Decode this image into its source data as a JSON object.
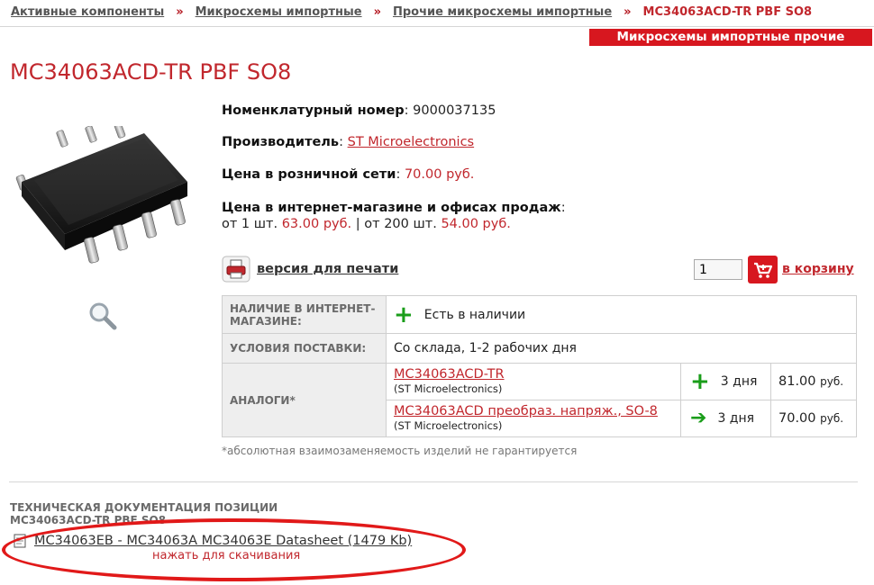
{
  "breadcrumb": {
    "items": [
      "Активные компоненты",
      "Микросхемы импортные",
      "Прочие микросхемы импортные"
    ],
    "separator": "»",
    "current": "MC34063ACD-TR PBF SO8"
  },
  "category_badge": "Микросхемы импортные прочие",
  "product": {
    "title": "MC34063ACD-TR PBF SO8",
    "nomenclature_label": "Номенклатурный номер",
    "nomenclature_value": "9000037135",
    "manufacturer_label": "Производитель",
    "manufacturer_value": "ST Microelectronics",
    "retail_price_label": "Цена в розничной сети",
    "retail_price_value": "70.00 руб.",
    "online_price_label": "Цена в интернет-магазине и офисах продаж",
    "tier1_prefix": "от 1 шт.",
    "tier1_price": "63.00 руб.",
    "tier_separator": "|",
    "tier2_prefix": "от 200 шт.",
    "tier2_price": "54.00 руб."
  },
  "actions": {
    "print_label": "версия для печати",
    "quantity_value": "1",
    "cart_label": "в корзину"
  },
  "specs": {
    "availability_label": "НАЛИЧИЕ В ИНТЕРНЕТ-МАГАЗИНЕ:",
    "availability_value": "Есть в наличии",
    "delivery_label": "УСЛОВИЯ ПОСТАВКИ:",
    "delivery_value": "Со склада, 1-2 рабочих дня",
    "analogs_label": "АНАЛОГИ*",
    "analogs": [
      {
        "name": "MC34063ACD-TR",
        "manufacturer": "(ST Microelectronics)",
        "term": "3 дня",
        "price": "81.00",
        "currency": "руб.",
        "icon": "plus-icon"
      },
      {
        "name": "MC34063ACD преобраз. напряж., SO-8",
        "manufacturer": "(ST Microelectronics)",
        "term": "3 дня",
        "price": "70.00",
        "currency": "руб.",
        "icon": "arrow-right-icon"
      }
    ]
  },
  "note": "*абсолютная взаимозаменяемость изделий не гарантируется",
  "docs": {
    "heading_line1": "ТЕХНИЧЕСКАЯ ДОКУМЕНТАЦИЯ ПОЗИЦИИ",
    "heading_line2": "MC34063ACD-TR PBF SO8",
    "file_label": "MC34063EB - MC34063A MC34063E Datasheet (1479 Kb)",
    "download_hint": "нажать для скачивания"
  },
  "colors": {
    "accent": "#c1272d",
    "badge": "#d7171f",
    "available": "#1a9d1a",
    "annotation": "#e11919"
  }
}
